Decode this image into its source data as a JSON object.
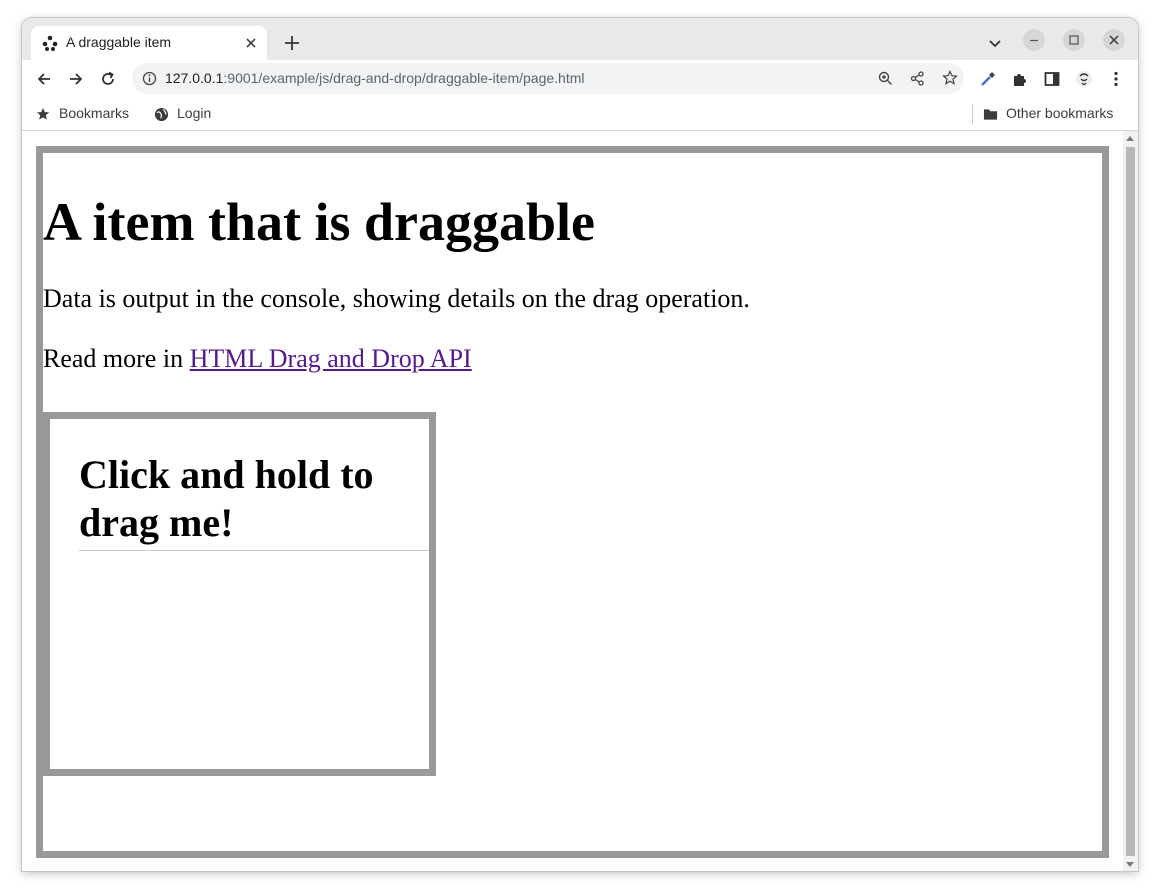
{
  "browser": {
    "tab": {
      "title": "A draggable item"
    },
    "url": {
      "host": "127.0.0.1",
      "path": ":9001/example/js/drag-and-drop/draggable-item/page.html"
    },
    "bookmarks": {
      "items": [
        {
          "label": "Bookmarks",
          "icon": "star-icon"
        },
        {
          "label": "Login",
          "icon": "globe-icon"
        }
      ],
      "other": {
        "label": "Other bookmarks",
        "icon": "folder-icon"
      }
    }
  },
  "page": {
    "heading": "A item that is draggable",
    "intro": "Data is output in the console, showing details on the drag operation.",
    "read_more_prefix": "Read more in ",
    "read_more_link": "HTML Drag and Drop API",
    "drag_item_title": "Click and hold to drag me!"
  },
  "colors": {
    "frame_border": "#999999",
    "link": "#551a8b"
  }
}
